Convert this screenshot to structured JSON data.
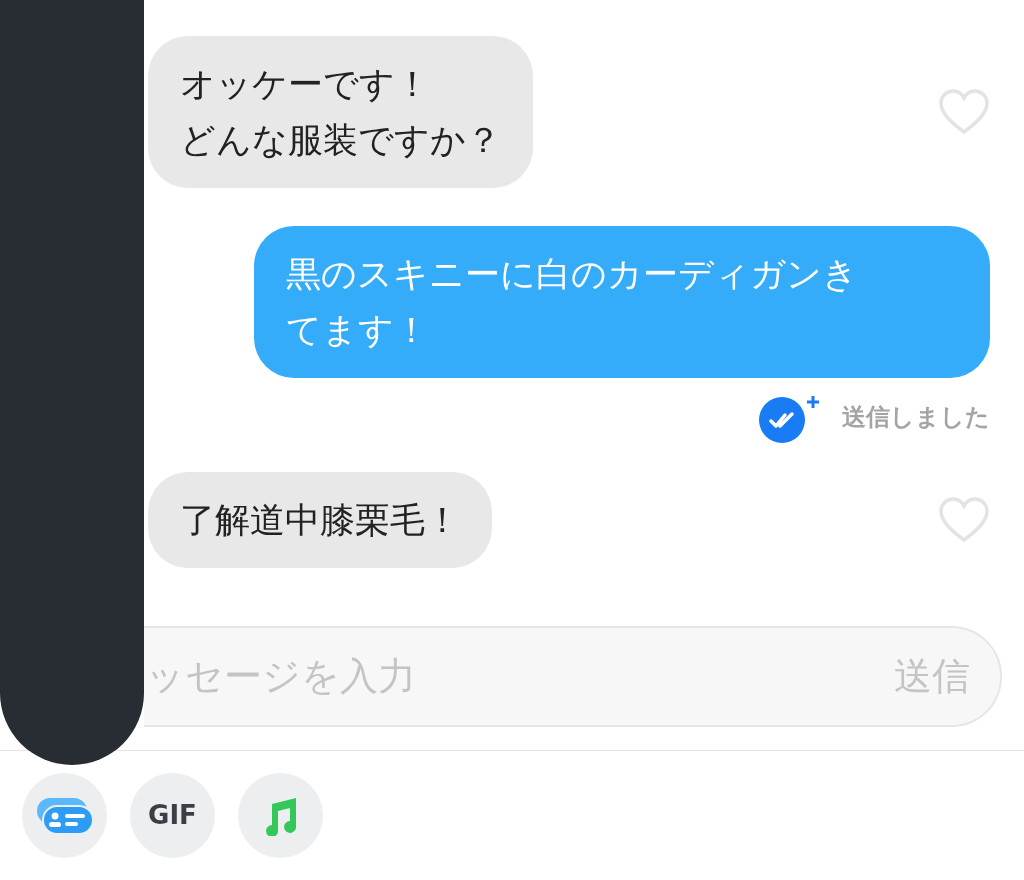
{
  "messages": [
    {
      "kind": "incoming",
      "lines": [
        "オッケーです！",
        "どんな服装ですか？"
      ],
      "liked": false
    },
    {
      "kind": "outgoing",
      "lines": [
        "黒のスキニーに白のカーディガンき",
        "てます！"
      ],
      "status": "送信しました"
    },
    {
      "kind": "incoming",
      "lines": [
        "了解道中膝栗毛！"
      ],
      "liked": false
    }
  ],
  "composer": {
    "placeholder": "ッセージを入力",
    "send": "送信"
  },
  "toolbar": [
    {
      "kind": "card"
    },
    {
      "kind": "gif",
      "label": "GIF"
    },
    {
      "kind": "music"
    }
  ]
}
